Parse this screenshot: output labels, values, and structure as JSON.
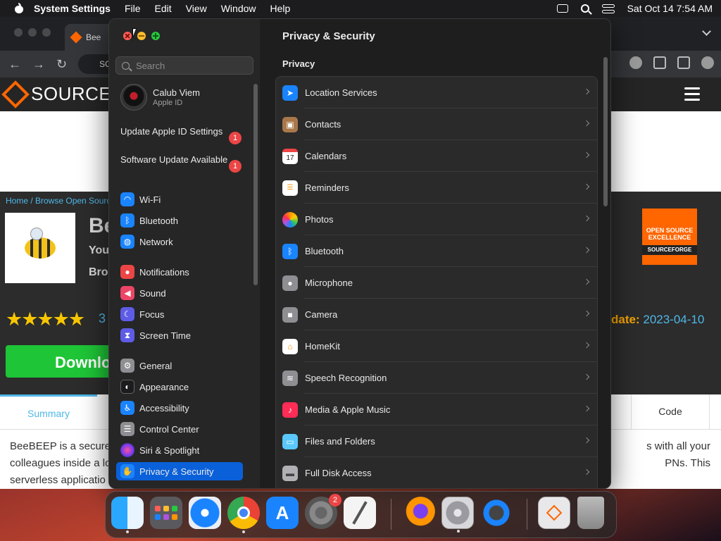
{
  "menubar": {
    "app_name": "System Settings",
    "menus": [
      "File",
      "Edit",
      "View",
      "Window",
      "Help"
    ],
    "datetime": "Sat Oct 14  7:54 AM"
  },
  "browser": {
    "tab_label": "Bee",
    "url_fragment": "SO",
    "site_logo_text": "SOURCEF",
    "breadcrumb": "Home / Browse Open Sourc",
    "project_title": "Be",
    "subtitle_1": "You",
    "subtitle_2": "Bro",
    "stars": "★★★★★",
    "rating_count": "3",
    "badge_line1": "OPEN SOURCE",
    "badge_line2": "EXCELLENCE",
    "badge_line3": "SOURCEFORGE",
    "update_label": "date:",
    "update_date": "2023-04-10",
    "download_label": "Downlo",
    "tab_summary": "Summary",
    "tab_code": "Code",
    "desc_line1_left": "BeeBEEP is a secure",
    "desc_line1_right": "s with all your",
    "desc_line2_left": "colleagues inside a lo",
    "desc_line2_right": "PNs. This",
    "desc_line3_left": "serverless applicatio"
  },
  "settings": {
    "search_placeholder": "Search",
    "account": {
      "name": "Calub Viem",
      "subtitle": "Apple ID"
    },
    "notices": [
      {
        "label": "Update Apple ID Settings",
        "badge": "1"
      },
      {
        "label": "Software Update Available",
        "badge": "1"
      }
    ],
    "sidebar": {
      "wifi": "Wi-Fi",
      "bluetooth": "Bluetooth",
      "network": "Network",
      "notifications": "Notifications",
      "sound": "Sound",
      "focus": "Focus",
      "screen_time": "Screen Time",
      "general": "General",
      "appearance": "Appearance",
      "accessibility": "Accessibility",
      "control_center": "Control Center",
      "siri": "Siri & Spotlight",
      "privacy": "Privacy & Security"
    },
    "content": {
      "title": "Privacy & Security",
      "section": "Privacy",
      "rows": [
        "Location Services",
        "Contacts",
        "Calendars",
        "Reminders",
        "Photos",
        "Bluetooth",
        "Microphone",
        "Camera",
        "HomeKit",
        "Speech Recognition",
        "Media & Apple Music",
        "Files and Folders",
        "Full Disk Access"
      ]
    },
    "calendar_icon_day": "17"
  },
  "dock": {
    "settings_badge": "2"
  },
  "colors": {
    "accent_selection": "#0a60d9",
    "badge_red": "#ec4545"
  }
}
